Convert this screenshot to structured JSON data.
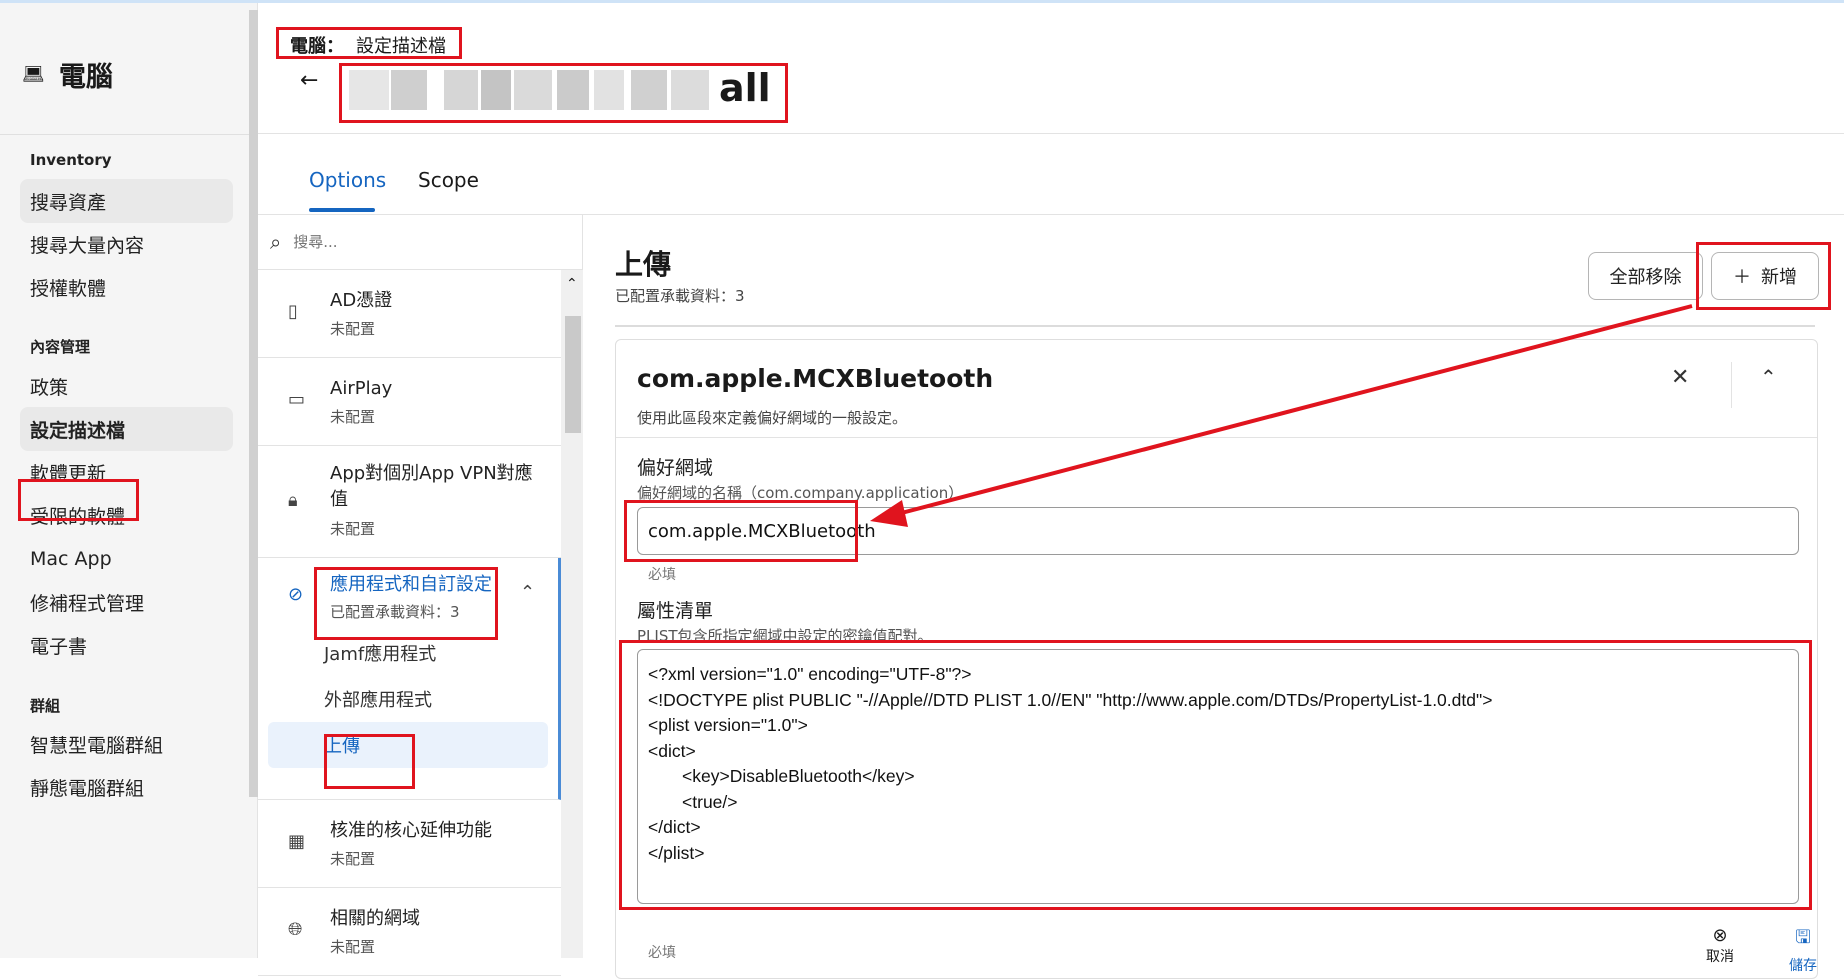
{
  "app": {
    "title": "電腦",
    "title_icon": "laptop-icon"
  },
  "nav": {
    "sections": [
      {
        "label": "Inventory",
        "items": [
          "搜尋資產",
          "搜尋大量內容",
          "授權軟體"
        ]
      },
      {
        "label": "內容管理",
        "items": [
          "政策",
          "設定描述檔",
          "軟體更新",
          "受限的軟體",
          "Mac App",
          "修補程式管理",
          "電子書"
        ]
      },
      {
        "label": "群組",
        "items": [
          "智慧型電腦群組",
          "靜態電腦群組"
        ]
      }
    ]
  },
  "header": {
    "breadcrumb_prefix": "電腦：",
    "breadcrumb_current": "設定描述檔",
    "title_suffix": "all"
  },
  "tabs": [
    {
      "label": "Options",
      "active": true
    },
    {
      "label": "Scope",
      "active": false
    }
  ],
  "search": {
    "placeholder": "搜尋..."
  },
  "payloads": [
    {
      "icon": "certificate-icon",
      "name": "AD憑證",
      "status": "未配置"
    },
    {
      "icon": "airplay-icon",
      "name": "AirPlay",
      "status": "未配置"
    },
    {
      "icon": "lock-icon",
      "name": "App對個別App VPN對應值",
      "status": "未配置"
    },
    {
      "icon": "block-icon",
      "name": "應用程式和自訂設定",
      "status": "已配置承載資料：3",
      "subitems": [
        "Jamf應用程式",
        "外部應用程式",
        "上傳"
      ]
    },
    {
      "icon": "chip-icon",
      "name": "核准的核心延伸功能",
      "status": "未配置"
    },
    {
      "icon": "globe-icon",
      "name": "相關的網域",
      "status": "未配置"
    }
  ],
  "panel": {
    "title": "上傳",
    "subtitle": "已配置承載資料：3",
    "remove_all_label": "全部移除",
    "add_label": "新增",
    "card": {
      "title": "com.apple.MCXBluetooth",
      "description": "使用此區段來定義偏好網域的一般設定。",
      "domain_label": "偏好網域",
      "domain_help": "偏好網域的名稱（com.company.application）",
      "domain_value": "com.apple.MCXBluetooth",
      "required_label": "必填",
      "plist_label": "屬性清單",
      "plist_help": "PLIST包含所指定網域中設定的密鑰值配對。",
      "plist_value": "<?xml version=\"1.0\" encoding=\"UTF-8\"?>\n<!DOCTYPE plist PUBLIC \"-//Apple//DTD PLIST 1.0//EN\" \"http://www.apple.com/DTDs/PropertyList-1.0.dtd\">\n<plist version=\"1.0\">\n<dict>\n       <key>DisableBluetooth</key>\n       <true/>\n</dict>\n</plist>"
    },
    "cancel_label": "取消",
    "save_label": "儲存"
  },
  "colors": {
    "accent": "#1565c0",
    "annotation": "#e0141e"
  }
}
